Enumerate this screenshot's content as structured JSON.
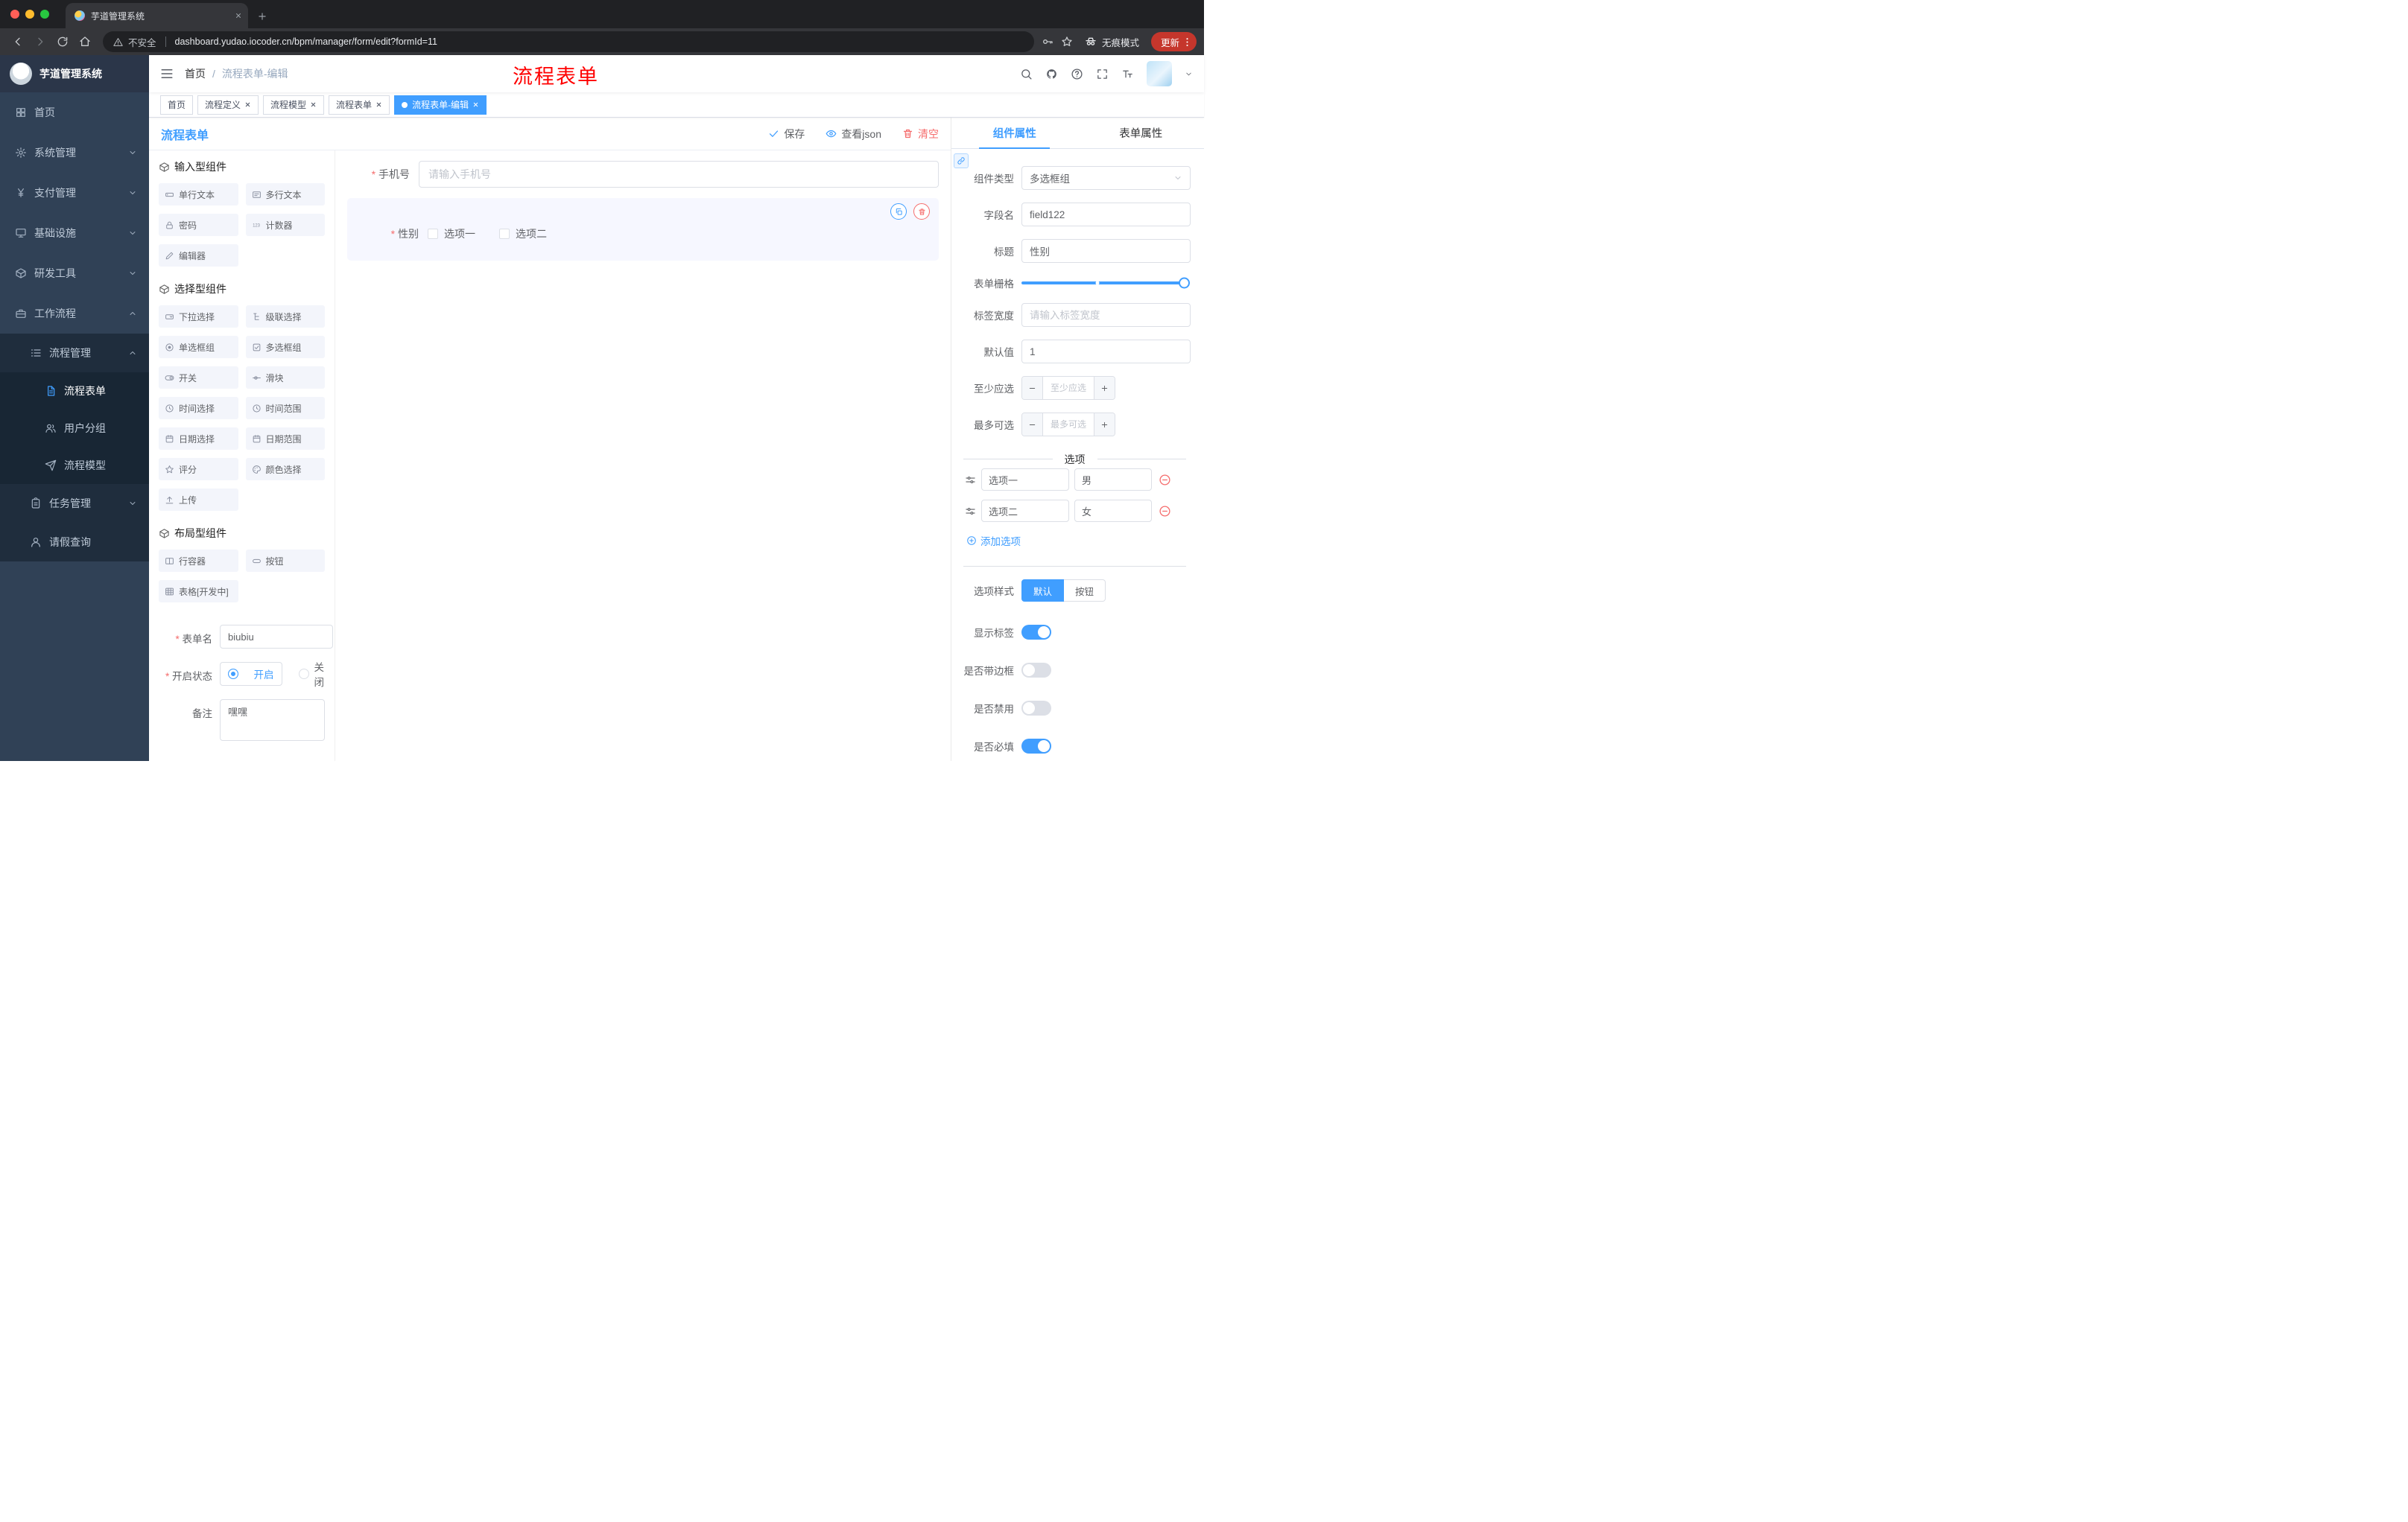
{
  "colors": {
    "accent": "#409eff",
    "danger": "#f56c6c",
    "annotation": "#ff0000",
    "sidebar_bg": "#304156",
    "sidebar_sub_bg": "#1f2d3d",
    "chrome_bg": "#202124",
    "chrome_toolbar_bg": "#35363a",
    "active_tag_bg": "#409eff"
  },
  "browser": {
    "tab_title": "芋道管理系统",
    "security_label": "不安全",
    "url": "dashboard.yudao.iocoder.cn/bpm/manager/form/edit?formId=11",
    "incognito_label": "无痕模式",
    "update_label": "更新"
  },
  "sidebar": {
    "logo_title": "芋道管理系统",
    "items": [
      {
        "label": "首页",
        "icon": "dashboard"
      },
      {
        "label": "系统管理",
        "icon": "gear"
      },
      {
        "label": "支付管理",
        "icon": "yen"
      },
      {
        "label": "基础设施",
        "icon": "monitor"
      },
      {
        "label": "研发工具",
        "icon": "box"
      },
      {
        "label": "工作流程",
        "icon": "briefcase"
      },
      {
        "label": "流程管理",
        "icon": "list"
      },
      {
        "label": "流程表单",
        "icon": "document"
      },
      {
        "label": "用户分组",
        "icon": "users"
      },
      {
        "label": "流程模型",
        "icon": "send"
      },
      {
        "label": "任务管理",
        "icon": "clipboard"
      },
      {
        "label": "请假查询",
        "icon": "user"
      }
    ]
  },
  "header": {
    "breadcrumb": [
      "首页",
      "流程表单-编辑"
    ],
    "breadcrumb_separator": "/",
    "annotation": "流程表单"
  },
  "tags": [
    {
      "label": "首页"
    },
    {
      "label": "流程定义"
    },
    {
      "label": "流程模型"
    },
    {
      "label": "流程表单"
    },
    {
      "label": "流程表单-编辑"
    }
  ],
  "designer": {
    "title": "流程表单",
    "toolbar": {
      "save": "保存",
      "view_json": "查看json",
      "clear": "清空"
    },
    "groups": [
      {
        "title": "输入型组件",
        "items": [
          "单行文本",
          "多行文本",
          "密码",
          "计数器",
          "编辑器"
        ]
      },
      {
        "title": "选择型组件",
        "items": [
          "下拉选择",
          "级联选择",
          "单选框组",
          "多选框组",
          "开关",
          "滑块",
          "时间选择",
          "时间范围",
          "日期选择",
          "日期范围",
          "评分",
          "颜色选择",
          "上传"
        ]
      },
      {
        "title": "布局型组件",
        "items": [
          "行容器",
          "按钮",
          "表格[开发中]"
        ]
      }
    ],
    "meta": {
      "form_name_label": "表单名",
      "form_name_value": "biubiu",
      "status_label": "开启状态",
      "status_on": "开启",
      "status_off": "关闭",
      "remark_label": "备注",
      "remark_value": "嘿嘿"
    }
  },
  "canvas": {
    "phone_label": "手机号",
    "phone_placeholder": "请输入手机号",
    "gender_label": "性别",
    "gender_options": [
      "选项一",
      "选项二"
    ]
  },
  "props": {
    "tabs": [
      "组件属性",
      "表单属性"
    ],
    "component_type_label": "组件类型",
    "component_type_value": "多选框组",
    "field_name_label": "字段名",
    "field_name_value": "field122",
    "title_label": "标题",
    "title_value": "性别",
    "grid_label": "表单栅格",
    "label_width_label": "标签宽度",
    "label_width_placeholder": "请输入标签宽度",
    "default_label": "默认值",
    "default_value": "1",
    "min_label": "至少应选",
    "min_placeholder": "至少应选",
    "max_label": "最多可选",
    "max_placeholder": "最多可选",
    "options_title": "选项",
    "options": [
      {
        "label": "选项一",
        "value": "男"
      },
      {
        "label": "选项二",
        "value": "女"
      }
    ],
    "add_option": "添加选项",
    "style_label": "选项样式",
    "style_default": "默认",
    "style_button": "按钮",
    "show_label": "显示标签",
    "border_label": "是否带边框",
    "disabled_label": "是否禁用",
    "required_label": "是否必填"
  }
}
